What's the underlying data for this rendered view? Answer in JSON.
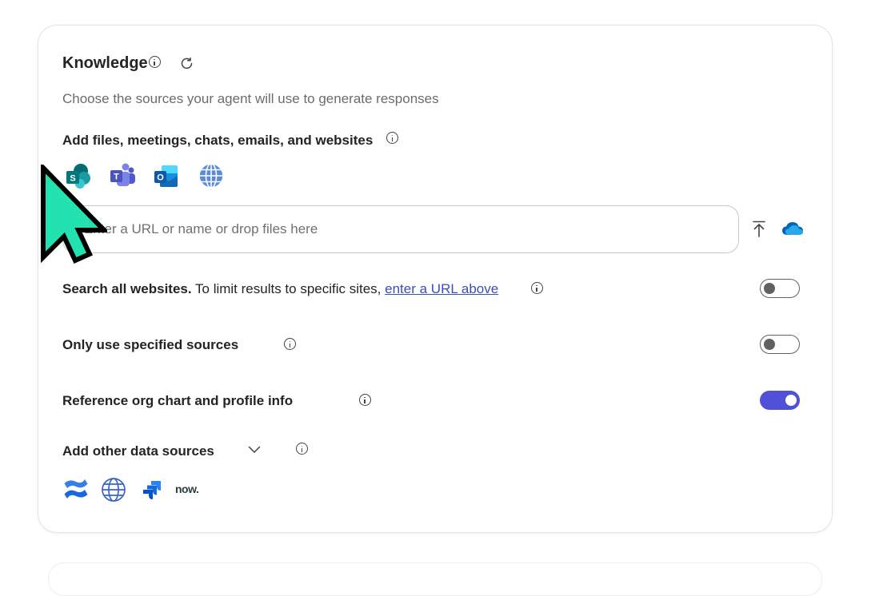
{
  "knowledge": {
    "title": "Knowledge",
    "subtitle": "Choose the sources your agent will use to generate responses",
    "add_sources_label": "Add files, meetings, chats, emails, and websites",
    "source_icons": [
      "sharepoint-icon",
      "teams-icon",
      "outlook-icon",
      "web-icon"
    ],
    "url_input": {
      "placeholder": "Enter a URL or name or drop files here",
      "value": ""
    },
    "search_all_websites": {
      "bold": "Search all websites.",
      "text": " To limit results to specific sites, ",
      "link": "enter a URL above",
      "enabled": false
    },
    "only_specified_sources": {
      "label": "Only use specified sources",
      "enabled": false
    },
    "reference_org_chart": {
      "label": "Reference org chart and profile info",
      "enabled": true
    },
    "other_sources": {
      "label": "Add other data sources",
      "icons": [
        "confluence-icon",
        "web-icon",
        "jira-icon",
        "servicenow-icon"
      ],
      "servicenow_text": "now."
    }
  },
  "colors": {
    "accent": "#4f52d8",
    "link": "#3b4db8",
    "cursor": "#22e3b0"
  }
}
